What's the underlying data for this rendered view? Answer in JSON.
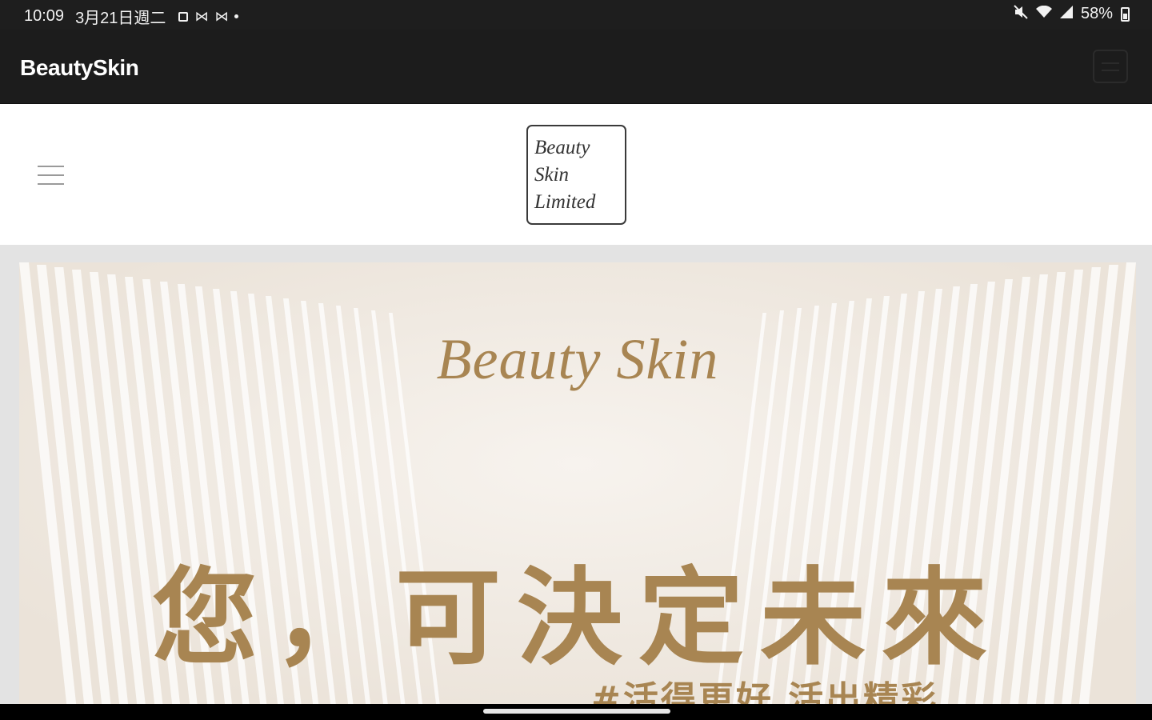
{
  "status_bar": {
    "time": "10:09",
    "date": "3月21日週二",
    "battery": "58%",
    "battery_level": 0.58,
    "icons": [
      "media-square-icon",
      "mail-icon",
      "mail-icon",
      "dot-icon",
      "mute-icon",
      "wifi-icon",
      "signal-icon",
      "battery-icon"
    ]
  },
  "app_bar": {
    "title": "BeautySkin"
  },
  "site_header": {
    "logo_lines": [
      "Beauty",
      "Skin",
      "Limited"
    ]
  },
  "banner": {
    "title": "Beauty Skin",
    "slogan": "您，可決定未來",
    "tagline": "#活得更好  活出精彩",
    "text_color": "#a88552"
  },
  "colors": {
    "status_bar_bg": "#1e1e1e",
    "app_bar_bg": "#1c1c1c",
    "page_bg": "#e3e3e3",
    "banner_bg": "#f2ece4",
    "accent_gold": "#a88552"
  }
}
